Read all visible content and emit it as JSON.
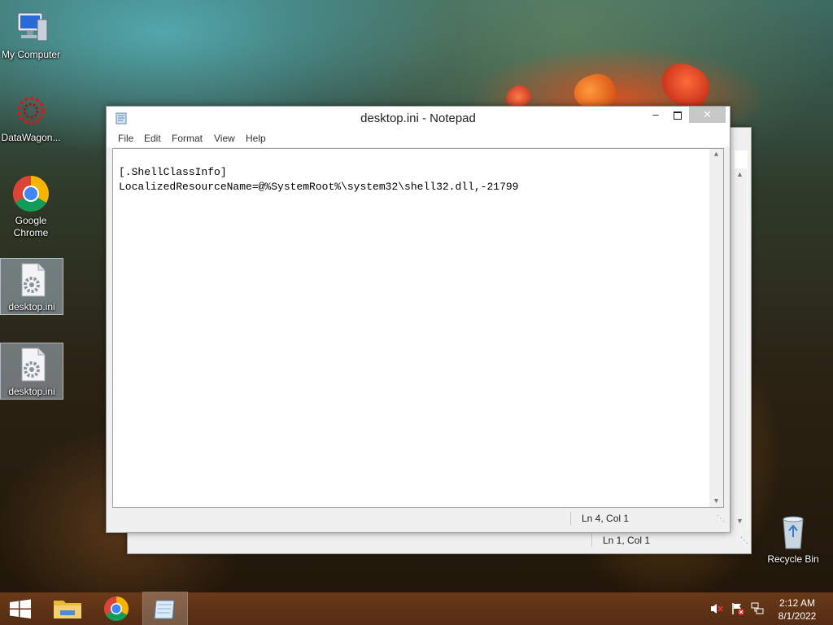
{
  "desktop": {
    "icons": [
      {
        "label": "My Computer"
      },
      {
        "label": "DataWagon..."
      },
      {
        "label": "Google\nChrome"
      },
      {
        "label": "desktop.ini"
      },
      {
        "label": "desktop.ini"
      },
      {
        "label": "Recycle Bin"
      }
    ]
  },
  "notepad_front": {
    "title": "desktop.ini - Notepad",
    "menu": [
      "File",
      "Edit",
      "Format",
      "View",
      "Help"
    ],
    "lines": [
      "",
      "[.ShellClassInfo]",
      "LocalizedResourceName=@%SystemRoot%\\system32\\shell32.dll,-21799"
    ],
    "status": "Ln 4, Col 1"
  },
  "notepad_back": {
    "status": "Ln 1, Col 1"
  },
  "taskbar": {
    "time": "2:12 AM",
    "date": "8/1/2022"
  },
  "colors": {
    "taskbar": "#6e3c19",
    "close_button": "#c7c7c7",
    "selection": "#c8dcf0"
  }
}
